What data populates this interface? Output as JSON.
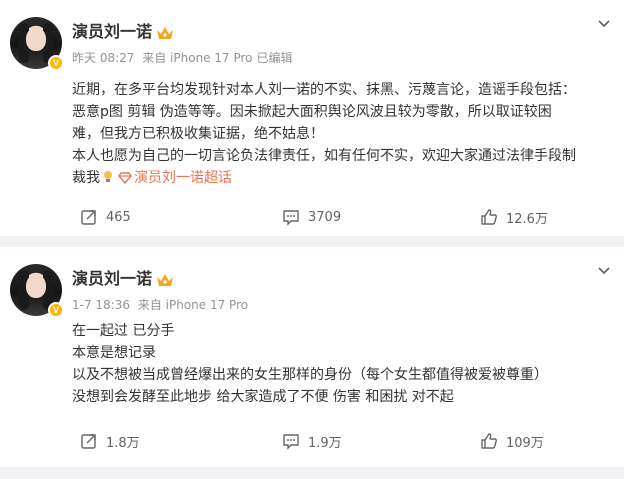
{
  "posts": [
    {
      "username": "演员刘一诺",
      "time": "昨天 08:27",
      "source": "来自 iPhone 17 Pro",
      "edited": "已编辑",
      "lines": [
        "近期，在多平台均发现针对本人刘一诺的不实、抹黑、污蔑言论，造谣手段包括：",
        "恶意p图 剪辑 伪造等等。因未掀起大面积舆论风波且较为零散，所以取证较困",
        "难，但我方已积极收集证据，绝不姑息！",
        "本人也愿为自己的一切言论负法律责任，如有任何不实，欢迎大家通过法律手段制"
      ],
      "last_line_prefix": "裁我",
      "topic": "演员刘一诺超话",
      "reposts": "465",
      "comments": "3709",
      "likes": "12.6万"
    },
    {
      "username": "演员刘一诺",
      "time": "1-7 18:36",
      "source": "来自 iPhone 17 Pro",
      "lines": [
        "在一起过 已分手",
        "本意是想记录",
        "以及不想被当成曾经爆出来的女生那样的身份（每个女生都值得被爱被尊重）",
        "没想到会发酵至此地步 给大家造成了不便 伤害 和困扰 对不起"
      ],
      "reposts": "1.8万",
      "comments": "1.9万",
      "likes": "109万"
    }
  ],
  "icons": {
    "verified": "verified-v-icon",
    "crown": "crown-icon",
    "chevron": "chevron-down-icon",
    "repost": "repost-icon",
    "comment": "comment-icon",
    "like": "thumbs-up-icon",
    "topic": "topic-diamond-icon"
  },
  "colors": {
    "topic": "#eb7350",
    "verified": "#ffb600",
    "meta": "#939393"
  }
}
